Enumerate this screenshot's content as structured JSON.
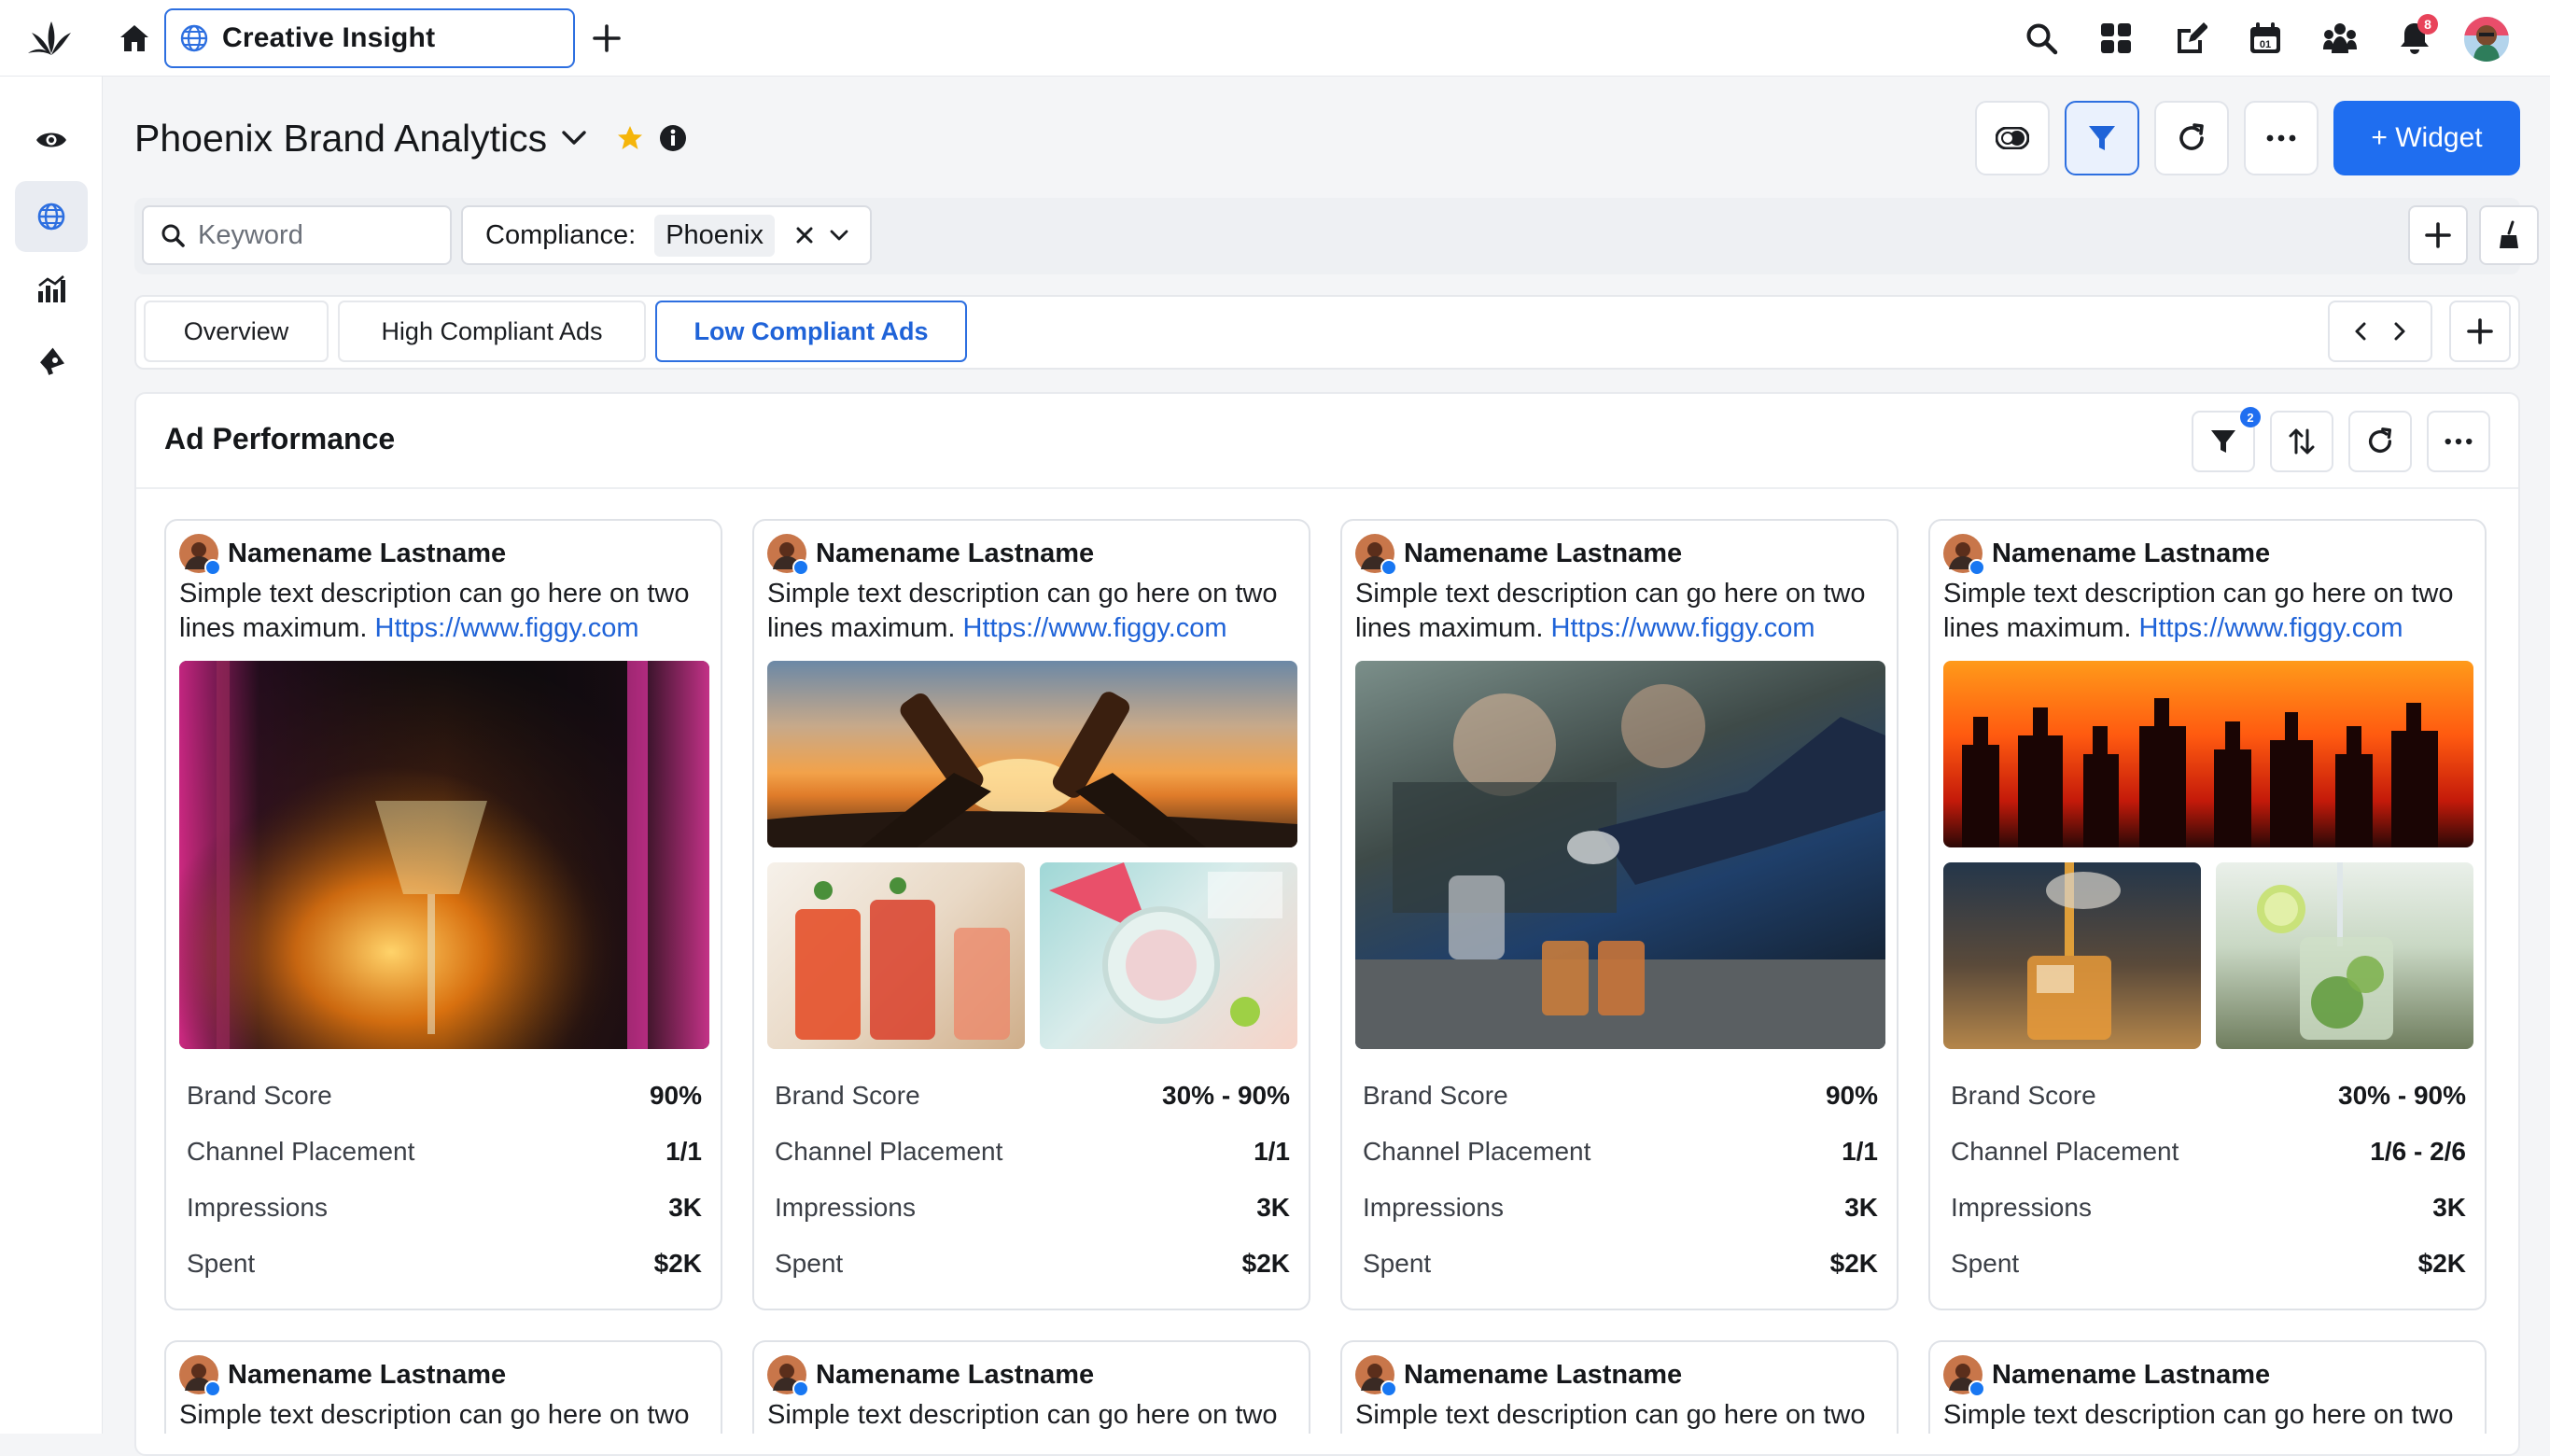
{
  "topbar": {
    "workspace_title": "Creative Insight",
    "notifications_count": "8"
  },
  "page": {
    "title": "Phoenix Brand Analytics",
    "widget_button_label": "+ Widget"
  },
  "filters": {
    "keyword_placeholder": "Keyword",
    "compliance_label": "Compliance:",
    "compliance_value": "Phoenix"
  },
  "tabs": [
    {
      "label": "Overview"
    },
    {
      "label": "High Compliant Ads"
    },
    {
      "label": "Low Compliant Ads"
    }
  ],
  "widget": {
    "title": "Ad Performance",
    "filter_count": "2"
  },
  "metric_labels": {
    "brand_score": "Brand Score",
    "channel_placement": "Channel Placement",
    "impressions": "Impressions",
    "spent": "Spent"
  },
  "cards": [
    {
      "author": "Namename Lastname",
      "desc": "Simple text description can go here on two lines maximum.",
      "url": "Https://www.figgy.com",
      "brand_score": "90%",
      "channel_placement": "1/1",
      "impressions": "3K",
      "spent": "$2K"
    },
    {
      "author": "Namename Lastname",
      "desc": "Simple text description can go here on two lines maximum.",
      "url": "Https://www.figgy.com",
      "brand_score": "30% - 90%",
      "channel_placement": "1/1",
      "impressions": "3K",
      "spent": "$2K"
    },
    {
      "author": "Namename Lastname",
      "desc": "Simple text description can go here on two lines maximum.",
      "url": "Https://www.figgy.com",
      "brand_score": "90%",
      "channel_placement": "1/1",
      "impressions": "3K",
      "spent": "$2K"
    },
    {
      "author": "Namename Lastname",
      "desc": "Simple text description can go here on two lines maximum.",
      "url": "Https://www.figgy.com",
      "brand_score": "30% - 90%",
      "channel_placement": "1/6 - 2/6",
      "impressions": "3K",
      "spent": "$2K"
    },
    {
      "author": "Namename Lastname",
      "desc": "Simple text description can go here on two"
    },
    {
      "author": "Namename Lastname",
      "desc": "Simple text description can go here on two"
    },
    {
      "author": "Namename Lastname",
      "desc": "Simple text description can go here on two"
    },
    {
      "author": "Namename Lastname",
      "desc": "Simple text description can go here on two"
    }
  ],
  "colors": {
    "accent": "#1f6ef0",
    "link": "#1f63d8",
    "notification_badge": "#e8435a"
  },
  "icons": {
    "topbar": [
      "app-logo-icon",
      "home-icon",
      "globe-icon",
      "plus-icon",
      "search-icon",
      "apps-grid-icon",
      "compose-icon",
      "calendar-icon",
      "community-icon",
      "bell-icon"
    ],
    "rail": [
      "eye-icon",
      "globe-icon",
      "analytics-icon",
      "megaphone-icon"
    ]
  }
}
